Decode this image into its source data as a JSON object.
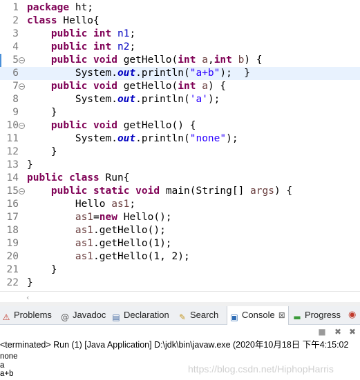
{
  "editor": {
    "lines": [
      {
        "n": "1",
        "tokens": [
          [
            "kw",
            "package"
          ],
          [
            "",
            ""
          ],
          [
            "",
            " ht;"
          ]
        ]
      },
      {
        "n": "2",
        "tokens": [
          [
            "kw",
            "class"
          ],
          [
            "",
            " Hello{"
          ]
        ]
      },
      {
        "n": "3",
        "tokens": [
          [
            "",
            "    "
          ],
          [
            "kw",
            "public"
          ],
          [
            "",
            " "
          ],
          [
            "kw",
            "int"
          ],
          [
            "",
            " "
          ],
          [
            "fld",
            "n1"
          ],
          [
            "",
            ";"
          ]
        ]
      },
      {
        "n": "4",
        "tokens": [
          [
            "",
            "    "
          ],
          [
            "kw",
            "public"
          ],
          [
            "",
            " "
          ],
          [
            "kw",
            "int"
          ],
          [
            "",
            " "
          ],
          [
            "fld",
            "n2"
          ],
          [
            "",
            ";"
          ]
        ]
      },
      {
        "n": "5",
        "fold": true,
        "diff": true,
        "tokens": [
          [
            "",
            "    "
          ],
          [
            "kw",
            "public"
          ],
          [
            "",
            " "
          ],
          [
            "kw",
            "void"
          ],
          [
            "",
            " getHello("
          ],
          [
            "kw",
            "int"
          ],
          [
            "",
            " "
          ],
          [
            "var",
            "a"
          ],
          [
            "",
            ","
          ],
          [
            "kw",
            "int"
          ],
          [
            "",
            " "
          ],
          [
            "var",
            "b"
          ],
          [
            "",
            ") {"
          ]
        ]
      },
      {
        "n": "6",
        "current": true,
        "tokens": [
          [
            "",
            "        System."
          ],
          [
            "stf",
            "out"
          ],
          [
            "",
            ".println("
          ],
          [
            "str",
            "\"a+b\""
          ],
          [
            "",
            ");  }"
          ]
        ]
      },
      {
        "n": "7",
        "fold": true,
        "tokens": [
          [
            "",
            "    "
          ],
          [
            "kw",
            "public"
          ],
          [
            "",
            " "
          ],
          [
            "kw",
            "void"
          ],
          [
            "",
            " getHello("
          ],
          [
            "kw",
            "int"
          ],
          [
            "",
            " "
          ],
          [
            "var",
            "a"
          ],
          [
            "",
            ") {"
          ]
        ]
      },
      {
        "n": "8",
        "tokens": [
          [
            "",
            "        System."
          ],
          [
            "stf",
            "out"
          ],
          [
            "",
            ".println("
          ],
          [
            "str",
            "'a'"
          ],
          [
            "",
            ");"
          ]
        ]
      },
      {
        "n": "9",
        "tokens": [
          [
            "",
            "    }"
          ]
        ]
      },
      {
        "n": "10",
        "fold": true,
        "tokens": [
          [
            "",
            "    "
          ],
          [
            "kw",
            "public"
          ],
          [
            "",
            " "
          ],
          [
            "kw",
            "void"
          ],
          [
            "",
            " getHello() {"
          ]
        ]
      },
      {
        "n": "11",
        "tokens": [
          [
            "",
            "        System."
          ],
          [
            "stf",
            "out"
          ],
          [
            "",
            ".println("
          ],
          [
            "str",
            "\"none\""
          ],
          [
            "",
            ");"
          ]
        ]
      },
      {
        "n": "12",
        "tokens": [
          [
            "",
            "    }"
          ]
        ]
      },
      {
        "n": "13",
        "tokens": [
          [
            "",
            "}"
          ]
        ]
      },
      {
        "n": "14",
        "tokens": [
          [
            "kw",
            "public"
          ],
          [
            "",
            " "
          ],
          [
            "kw",
            "class"
          ],
          [
            "",
            " Run{"
          ]
        ]
      },
      {
        "n": "15",
        "fold": true,
        "tokens": [
          [
            "",
            "    "
          ],
          [
            "kw",
            "public"
          ],
          [
            "",
            " "
          ],
          [
            "kw",
            "static"
          ],
          [
            "",
            " "
          ],
          [
            "kw",
            "void"
          ],
          [
            "",
            " main(String[] "
          ],
          [
            "var",
            "args"
          ],
          [
            "",
            ") {"
          ]
        ]
      },
      {
        "n": "16",
        "tokens": [
          [
            "",
            "        Hello "
          ],
          [
            "var",
            "as1"
          ],
          [
            "",
            ";"
          ]
        ]
      },
      {
        "n": "17",
        "tokens": [
          [
            "",
            "        "
          ],
          [
            "var",
            "as1"
          ],
          [
            "",
            "="
          ],
          [
            "kw",
            "new"
          ],
          [
            "",
            " Hello();"
          ]
        ]
      },
      {
        "n": "18",
        "tokens": [
          [
            "",
            "        "
          ],
          [
            "var",
            "as1"
          ],
          [
            "",
            ".getHello();"
          ]
        ]
      },
      {
        "n": "19",
        "tokens": [
          [
            "",
            "        "
          ],
          [
            "var",
            "as1"
          ],
          [
            "",
            ".getHello(1);"
          ]
        ]
      },
      {
        "n": "20",
        "tokens": [
          [
            "",
            "        "
          ],
          [
            "var",
            "as1"
          ],
          [
            "",
            ".getHello(1, 2);"
          ]
        ]
      },
      {
        "n": "21",
        "tokens": [
          [
            "",
            "    }"
          ]
        ]
      },
      {
        "n": "22",
        "tokens": [
          [
            "",
            "}"
          ]
        ]
      }
    ]
  },
  "panel": {
    "tabs": [
      {
        "label": "Problems",
        "icon": "problems-icon",
        "glyph": "⚠",
        "color": "#c0392b"
      },
      {
        "label": "Javadoc",
        "icon": "javadoc-icon",
        "glyph": "@",
        "color": "#555555"
      },
      {
        "label": "Declaration",
        "icon": "declaration-icon",
        "glyph": "▤",
        "color": "#4a6fa5"
      },
      {
        "label": "Search",
        "icon": "search-icon",
        "glyph": "✎",
        "color": "#c49a2c"
      },
      {
        "label": "Console",
        "icon": "console-icon",
        "glyph": "▣",
        "color": "#2f6db5",
        "active": true,
        "close": "⊠"
      },
      {
        "label": "Progress",
        "icon": "progress-icon",
        "glyph": "▬",
        "color": "#3a9a3a"
      }
    ],
    "overflow_glyph": "◉"
  },
  "console": {
    "header": "<terminated> Run (1) [Java Application] D:\\jdk\\bin\\javaw.exe  (2020年10月18日 下午4:15:02",
    "output": [
      "none",
      "a",
      "a+b"
    ],
    "watermark": "https://blog.csdn.net/HiphopHarris"
  },
  "colors": {
    "keyword": "#7f0055",
    "string": "#2a00ff",
    "field": "#0000c0",
    "local_var": "#6a3e3e",
    "current_line": "#e8f2fe"
  }
}
